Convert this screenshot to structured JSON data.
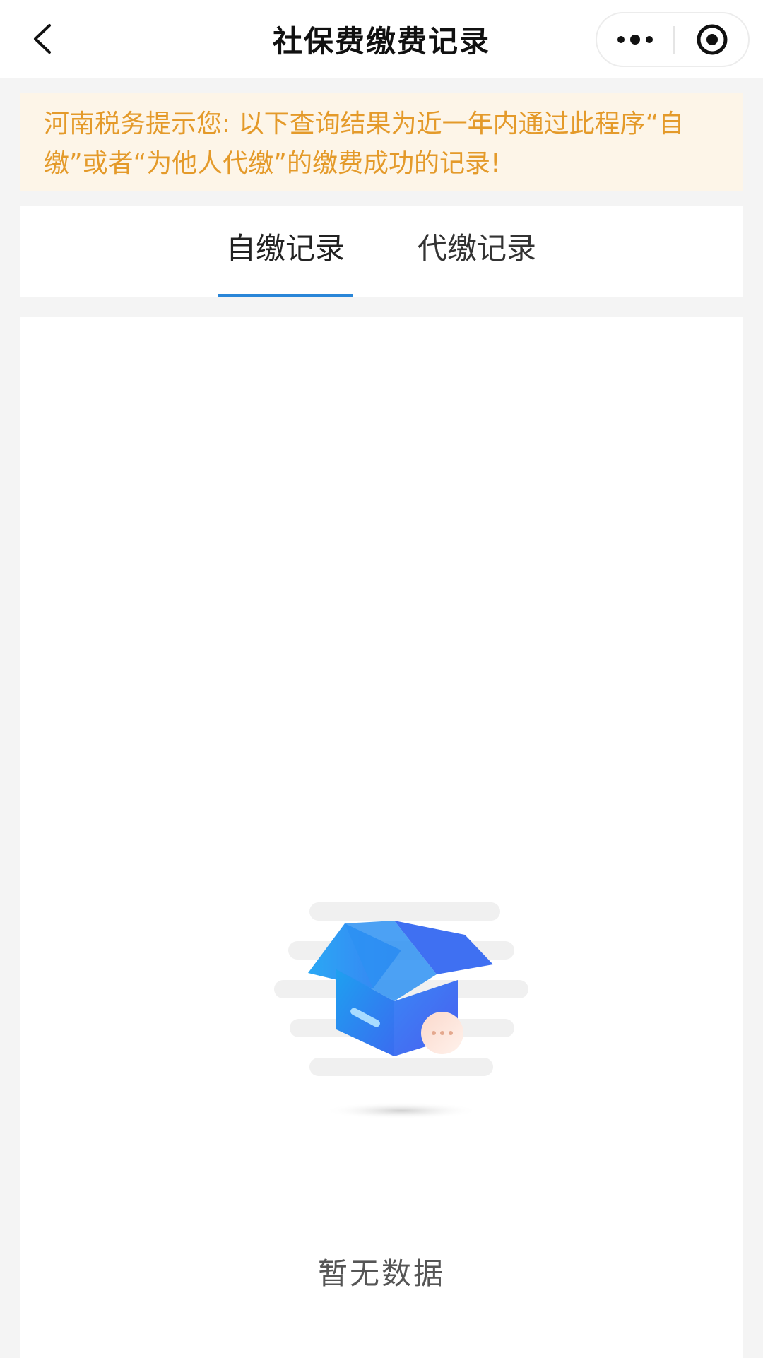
{
  "navbar": {
    "title": "社保费缴费记录",
    "back_icon": "chevron-left-icon",
    "more_icon": "more-dots-icon",
    "close_icon": "target-circle-icon"
  },
  "notice": {
    "text": "河南税务提示您: 以下查询结果为近一年内通过此程序“自缴”或者“为他人代缴”的缴费成功的记录!",
    "color": "#e49a2a",
    "background": "#fdf5e8"
  },
  "tabs": [
    {
      "label": "自缴记录",
      "active": true
    },
    {
      "label": "代缴记录",
      "active": false
    }
  ],
  "accent_color": "#2a86d8",
  "empty_state": {
    "icon": "empty-box-icon",
    "text": "暂无数据"
  }
}
